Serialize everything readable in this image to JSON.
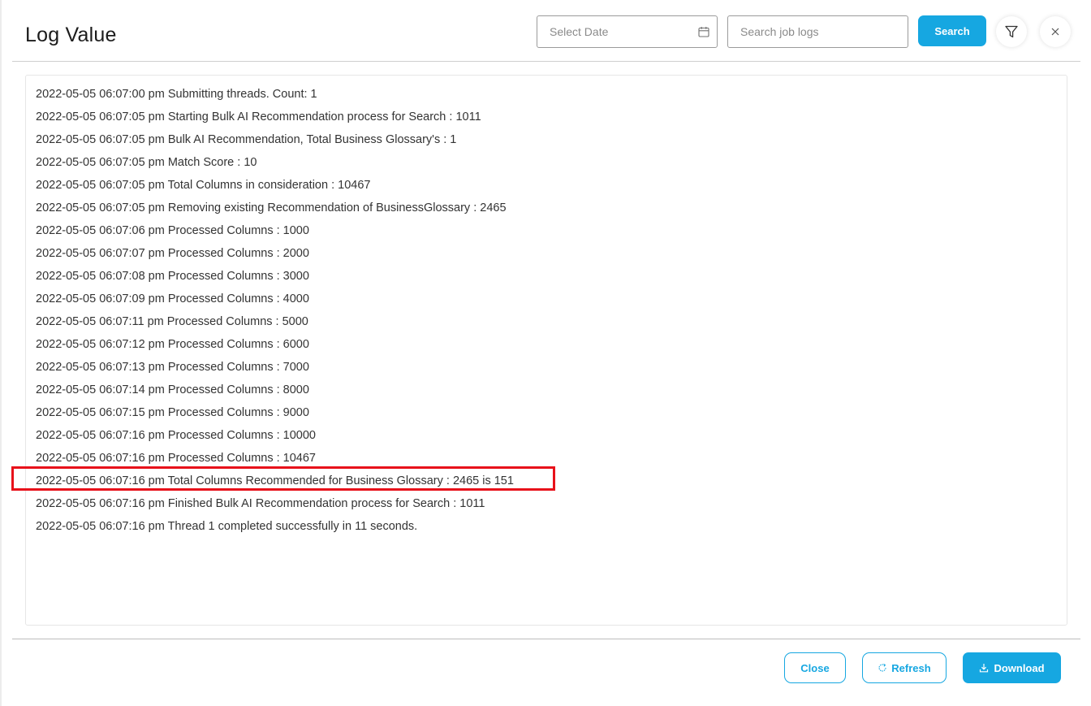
{
  "modal": {
    "title": "Log Value"
  },
  "header": {
    "date_placeholder": "Select Date",
    "search_placeholder": "Search job logs",
    "search_label": "Search",
    "filter_icon": "filter-icon",
    "close_icon": "close-icon",
    "calendar_icon": "calendar-icon"
  },
  "log": {
    "lines": [
      "2022-05-05 06:07:00 pm Submitting threads. Count: 1",
      "2022-05-05 06:07:05 pm Starting Bulk AI Recommendation process for Search : 1011",
      "2022-05-05 06:07:05 pm Bulk AI Recommendation, Total Business Glossary's : 1",
      "2022-05-05 06:07:05 pm Match Score : 10",
      "2022-05-05 06:07:05 pm Total Columns in consideration : 10467",
      "2022-05-05 06:07:05 pm Removing existing Recommendation of BusinessGlossary : 2465",
      "2022-05-05 06:07:06 pm Processed Columns : 1000",
      "2022-05-05 06:07:07 pm Processed Columns : 2000",
      "2022-05-05 06:07:08 pm Processed Columns : 3000",
      "2022-05-05 06:07:09 pm Processed Columns : 4000",
      "2022-05-05 06:07:11 pm Processed Columns : 5000",
      "2022-05-05 06:07:12 pm Processed Columns : 6000",
      "2022-05-05 06:07:13 pm Processed Columns : 7000",
      "2022-05-05 06:07:14 pm Processed Columns : 8000",
      "2022-05-05 06:07:15 pm Processed Columns : 9000",
      "2022-05-05 06:07:16 pm Processed Columns : 10000",
      "2022-05-05 06:07:16 pm Processed Columns : 10467",
      "2022-05-05 06:07:16 pm Total Columns Recommended for Business Glossary : 2465 is 151",
      "2022-05-05 06:07:16 pm Finished Bulk AI Recommendation process for Search : 1011",
      "2022-05-05 06:07:16 pm Thread 1 completed successfully in 11 seconds."
    ],
    "highlight_color": "#e8111a"
  },
  "footer": {
    "close_label": "Close",
    "refresh_label": "Refresh",
    "download_label": "Download",
    "refresh_icon": "refresh-icon",
    "download_icon": "download-icon"
  },
  "colors": {
    "accent": "#16a7e1"
  }
}
